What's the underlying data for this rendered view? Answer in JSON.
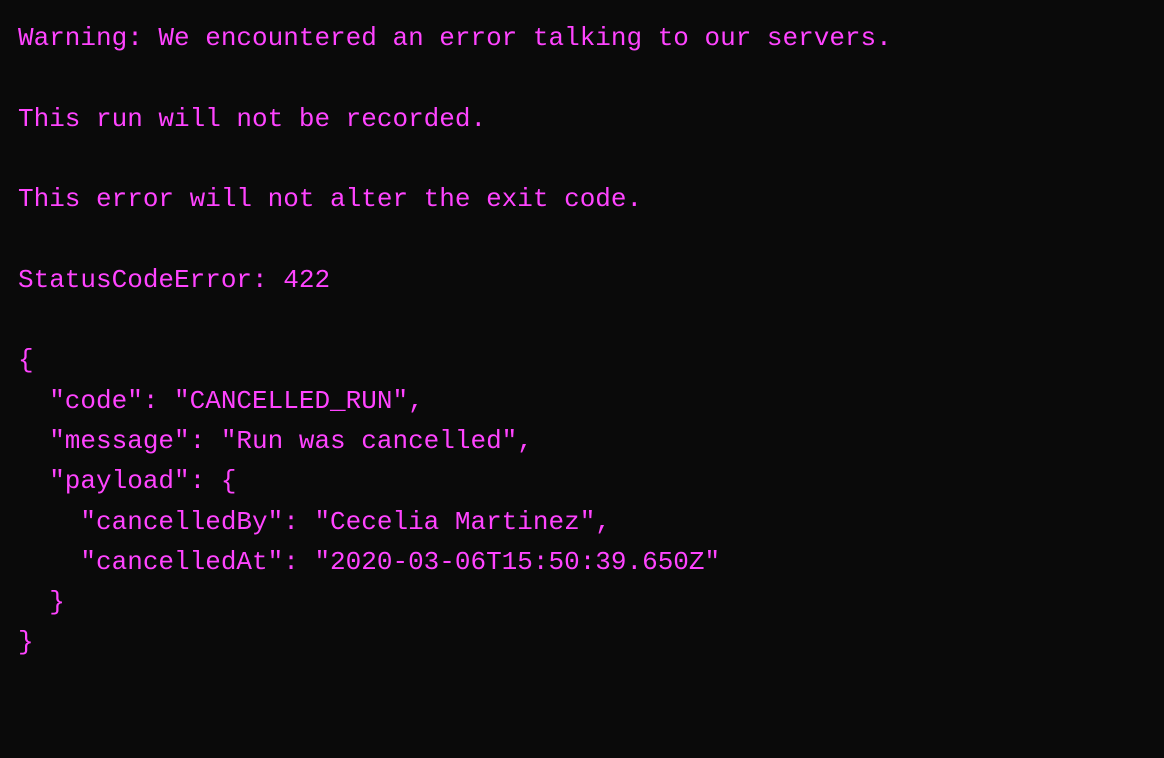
{
  "terminal": {
    "background": "#0a0a0a",
    "text_color": "#ff44ff",
    "lines": [
      {
        "id": "warning-line",
        "text": "Warning: We encountered an error talking to our servers."
      },
      {
        "id": "empty-1",
        "text": ""
      },
      {
        "id": "not-recorded",
        "text": "This run will not be recorded."
      },
      {
        "id": "empty-2",
        "text": ""
      },
      {
        "id": "exit-code",
        "text": "This error will not alter the exit code."
      },
      {
        "id": "empty-3",
        "text": ""
      },
      {
        "id": "status-code",
        "text": "StatusCodeError: 422"
      },
      {
        "id": "empty-4",
        "text": ""
      },
      {
        "id": "json-open",
        "text": "{"
      },
      {
        "id": "json-code",
        "text": "  \"code\": \"CANCELLED_RUN\","
      },
      {
        "id": "json-message",
        "text": "  \"message\": \"Run was cancelled\","
      },
      {
        "id": "json-payload-open",
        "text": "  \"payload\": {"
      },
      {
        "id": "json-cancelled-by",
        "text": "    \"cancelledBy\": \"Cecelia Martinez\","
      },
      {
        "id": "json-cancelled-at",
        "text": "    \"cancelledAt\": \"2020-03-06T15:50:39.650Z\""
      },
      {
        "id": "json-payload-close",
        "text": "  }"
      },
      {
        "id": "json-close",
        "text": "}"
      }
    ]
  }
}
